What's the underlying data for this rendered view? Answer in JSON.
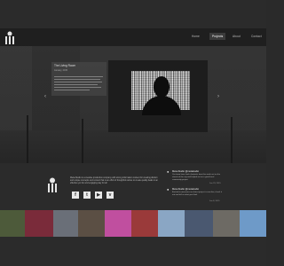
{
  "nav": {
    "items": [
      {
        "label": "Home"
      },
      {
        "label": "Projects"
      },
      {
        "label": "About"
      },
      {
        "label": "Contact"
      }
    ],
    "active_index": 1
  },
  "hero": {
    "panel_title": "The Living Room",
    "panel_date": "January, 2015"
  },
  "footer": {
    "about_text": "Meta-Studio is a creative production company with strong information content for creating distinct and unique concepts and content that is an effort of thoughtful stories to create quality deals in an effective yet fun and engaging way for all",
    "social": [
      {
        "icon": "facebook-icon",
        "glyph": "f"
      },
      {
        "icon": "twitter-icon",
        "glyph": "t"
      },
      {
        "icon": "youtube-icon",
        "glyph": "▶"
      },
      {
        "icon": "vimeo-icon",
        "glyph": "v"
      }
    ],
    "tweets": [
      {
        "name": "Meta-Studio",
        "handle": "@metastudio",
        "text": "Our team have had a fantastic time this week out on the streets of the city and helped out on a great local community project",
        "date": "Jan 23, 2015"
      },
      {
        "name": "Meta-Studio",
        "handle": "@metastudio",
        "text": "Excited to announce our latest project is now live, check it out and tell us what you think",
        "date": "Jan 8, 2015"
      }
    ]
  },
  "photos": [
    {
      "name": "photo-market",
      "color": "#4d5a3a"
    },
    {
      "name": "photo-red-fruit",
      "color": "#7a2b3a"
    },
    {
      "name": "photo-street",
      "color": "#6a6f78"
    },
    {
      "name": "photo-crowd",
      "color": "#5b4f44"
    },
    {
      "name": "photo-rainbow",
      "color": "#c04f9f"
    },
    {
      "name": "photo-lights",
      "color": "#9a3a3a"
    },
    {
      "name": "photo-sky",
      "color": "#8aa6c4"
    },
    {
      "name": "photo-festival",
      "color": "#4a5870"
    },
    {
      "name": "photo-people",
      "color": "#6d6a64"
    },
    {
      "name": "photo-blue-sky",
      "color": "#6e9ac8"
    }
  ]
}
